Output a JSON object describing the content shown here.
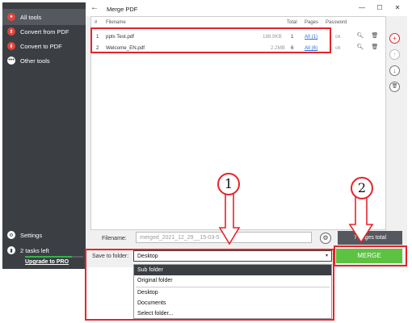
{
  "sidebar": {
    "items": [
      {
        "label": "All tools",
        "icon": "all-tools-icon"
      },
      {
        "label": "Convert from PDF",
        "icon": "convert-from-pdf-icon"
      },
      {
        "label": "Convert to PDF",
        "icon": "convert-to-pdf-icon"
      },
      {
        "label": "Other tools",
        "icon": "more-dots-icon"
      }
    ],
    "settings_label": "Settings",
    "tasks_left": "2 tasks left",
    "tasks_progress": 0.8,
    "upgrade_label": "Upgrade to PRO"
  },
  "window": {
    "title": "Merge PDF",
    "back_icon": "←",
    "minimize_icon": "—",
    "maximize_icon": "☐",
    "close_icon": "✕"
  },
  "table": {
    "headers": {
      "num": "#",
      "filename": "Filename",
      "total": "Total",
      "pages": "Pages",
      "password": "Password"
    },
    "rows": [
      {
        "num": "1",
        "filename": "pptx Test.pdf",
        "size": "188.9KB",
        "total": "1",
        "pages": "All (1)",
        "password": "ok"
      },
      {
        "num": "2",
        "filename": "Welcome_EN.pdf",
        "size": "2.2MB",
        "total": "6",
        "pages": "All (6)",
        "password": "ok"
      }
    ]
  },
  "side_buttons": {
    "add": "+",
    "up": "↑",
    "down": "↓",
    "delete": "🗑"
  },
  "footer": {
    "filename_label": "Filename:",
    "filename_value": "merged_2021_12_29__15-03-5",
    "pages_total": "7 pages total",
    "save_to_label": "Save to folder:",
    "save_to_value": "Desktop",
    "merge_label": "MERGE"
  },
  "dropdown": {
    "options": [
      "Sub folder",
      "Original folder",
      "Desktop",
      "Documents",
      "Select folder..."
    ],
    "highlighted_index": 0
  },
  "annotations": {
    "step1": "1",
    "step2": "2"
  },
  "colors": {
    "accent_red": "#e6232b",
    "merge_green": "#5dc242",
    "sidebar_bg": "#3b3f44"
  }
}
